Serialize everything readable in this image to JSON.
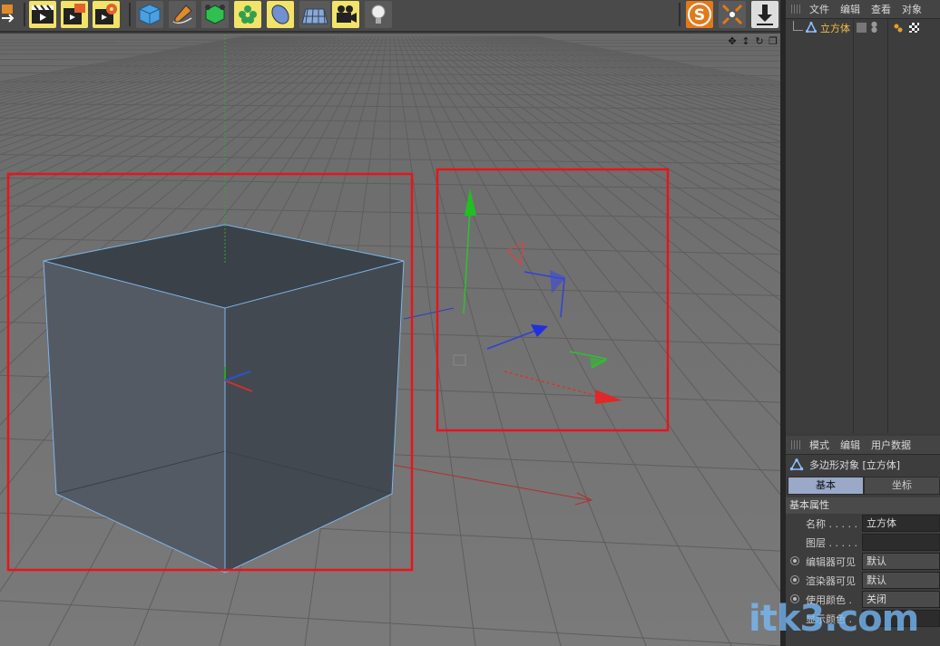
{
  "object_manager": {
    "menu": [
      "文件",
      "编辑",
      "查看",
      "对象"
    ],
    "object_name": "立方体"
  },
  "attribute_manager": {
    "menu": [
      "模式",
      "编辑",
      "用户数据"
    ],
    "object_title": "多边形对象 [立方体]",
    "tabs": [
      "基本",
      "坐标"
    ],
    "section": "基本属性",
    "fields": [
      {
        "label": "名称 . . . . .",
        "value": "立方体"
      },
      {
        "label": "图层 . . . . .",
        "value": ""
      },
      {
        "label": "编辑器可见",
        "value": "默认"
      },
      {
        "label": "渲染器可见",
        "value": "默认"
      },
      {
        "label": "使用颜色 .",
        "value": "关闭"
      },
      {
        "label": "显示颜色 .",
        "value": ""
      }
    ]
  },
  "watermark": "itk3.com",
  "colors": {
    "highlight_box": "#e8141c",
    "axis_x": "#e03030",
    "axis_y": "#20c020",
    "axis_z": "#2040e0",
    "selection_edge": "#7fb4e8"
  },
  "icons": [
    "render-view-icon",
    "render-picture-viewer-icon",
    "render-settings-icon",
    "cube-icon",
    "pen-spline-icon",
    "generator-icon",
    "cloner-icon",
    "deformer-icon",
    "floor-icon",
    "camera-icon",
    "light-icon",
    "snap-icon",
    "axis-lock-icon",
    "drop-icon"
  ]
}
